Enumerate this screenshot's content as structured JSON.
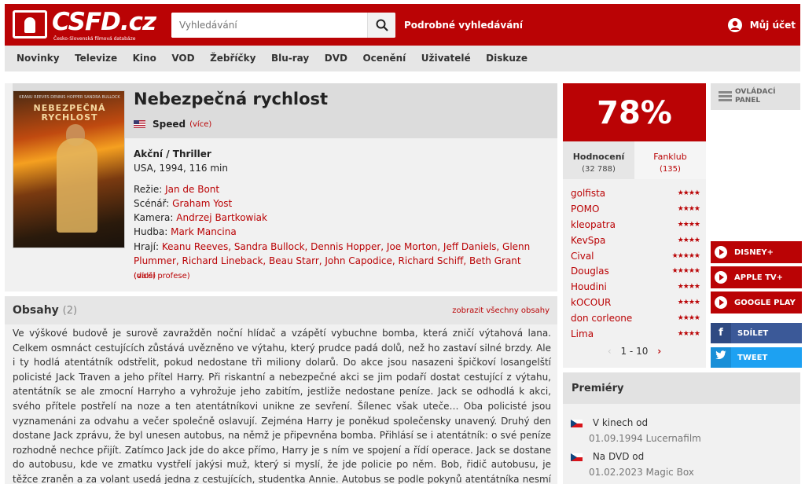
{
  "header": {
    "logo_text": "CSFD.cz",
    "logo_sub": "Česko-Slovenská filmová databáze",
    "search_placeholder": "Vyhledávání",
    "advanced_search": "Podrobné vyhledávání",
    "account": "Můj účet"
  },
  "nav": [
    "Novinky",
    "Televize",
    "Kino",
    "VOD",
    "Žebříčky",
    "Blu-ray",
    "DVD",
    "Ocenění",
    "Uživatelé",
    "Diskuze"
  ],
  "film": {
    "title": "Nebezpečná rychlost",
    "original_title": "Speed",
    "more": "(více)",
    "genre": "Akční / Thriller",
    "origin": "USA, 1994, 116 min",
    "poster_title": "NEBEZPEČNÁ RYCHLOST",
    "poster_cast": "KEANU REEVES  DENNIS HOPPER  SANDRA BULLOCK",
    "crew": {
      "director_label": "Režie:",
      "director": "Jan de Bont",
      "writer_label": "Scénář:",
      "writer": "Graham Yost",
      "camera_label": "Kamera:",
      "camera": "Andrzej Bartkowiak",
      "music_label": "Hudba:",
      "music": "Mark Mancina",
      "cast_label": "Hrají:",
      "cast": "Keanu Reeves, Sandra Bullock, Dennis Hopper, Joe Morton, Jeff Daniels, Glenn Plummer, Richard Lineback, Beau Starr, John Capodice, Richard Schiff, Beth Grant",
      "cast_more": "(více)",
      "more_professions": "(další profese)"
    }
  },
  "synopsis": {
    "title": "Obsahy",
    "count": "(2)",
    "show_all": "zobrazit všechny obsahy",
    "text": "Ve výškové budově je surově zavražděn noční hlídač a vzápětí vybuchne bomba, která zničí výtahová lana. Celkem osmnáct cestujících zůstává uvězněno ve výtahu, který prudce padá dolů, než ho zastaví silné brzdy. Ale i ty hodlá atentátník odstřelit, pokud nedostane tři miliony dolarů. Do akce jsou nasazeni špičkoví losangelští policisté Jack Traven a jeho přítel Harry. Při riskantní a nebezpečné akci se jim podaří dostat cestující z výtahu, atentátník se ale zmocní Harryho a vyhrožuje jeho zabitím, jestliže nedostane peníze. Jack se odhodlá k akci, svého přítele postřelí na noze a ten atentátníkovi unikne ze sevření. Šílenec však uteče… Oba policisté jsou vyznamenáni za odvahu a večer společně oslavují. Zejména Harry je poněkud společensky unavený. Druhý den dostane Jack zprávu, že byl unesen autobus, na němž je připevněna bomba. Přihlásí se i atentátník: o své peníze rozhodně nechce přijít. Zatímco Jack jde do akce přímo, Harry je s ním ve spojení a řídí operace. Jack se dostane do autobusu, kde ve zmatku vystřelí jakýsi muž, který si myslí, že jde policie po něm. Bob, řidič autobusu, je těžce zraněn a za volant usedá jedna z cestujících, studentka Annie. Autobus se podle pokynů atentátníka nesmí dostat pod určitou rychlost, jinak nálož vybuchne…"
  },
  "rating": {
    "score": "78%",
    "tab_ratings": "Hodnocení",
    "tab_ratings_count": "(32 788)",
    "tab_fanclub": "Fanklub",
    "tab_fanclub_count": "(135)",
    "users": [
      {
        "name": "golfista",
        "stars": 4
      },
      {
        "name": "POMO",
        "stars": 4
      },
      {
        "name": "kleopatra",
        "stars": 4
      },
      {
        "name": "KevSpa",
        "stars": 4
      },
      {
        "name": "Cival",
        "stars": 5
      },
      {
        "name": "Douglas",
        "stars": 5
      },
      {
        "name": "Houdini",
        "stars": 4
      },
      {
        "name": "kOCOUR",
        "stars": 4
      },
      {
        "name": "don corleone",
        "stars": 4
      },
      {
        "name": "Lima",
        "stars": 4
      }
    ],
    "pager": "1 - 10"
  },
  "sidebar": {
    "panel": "OVLÁDACÍ PANEL",
    "vod": [
      "DISNEY+",
      "APPLE TV+",
      "GOOGLE PLAY"
    ],
    "share": "SDÍLET",
    "tweet": "TWEET"
  },
  "premieres": {
    "title": "Premiéry",
    "rows": [
      {
        "label": "V kinech od",
        "detail": "01.09.1994 Lucernafilm"
      },
      {
        "label": "Na DVD od",
        "detail": "01.02.2023 Magic Box"
      }
    ]
  },
  "colors": {
    "accent": "#ba0305",
    "panel_bg": "#f1f1f1",
    "nav_bg": "#e6e6e6"
  }
}
